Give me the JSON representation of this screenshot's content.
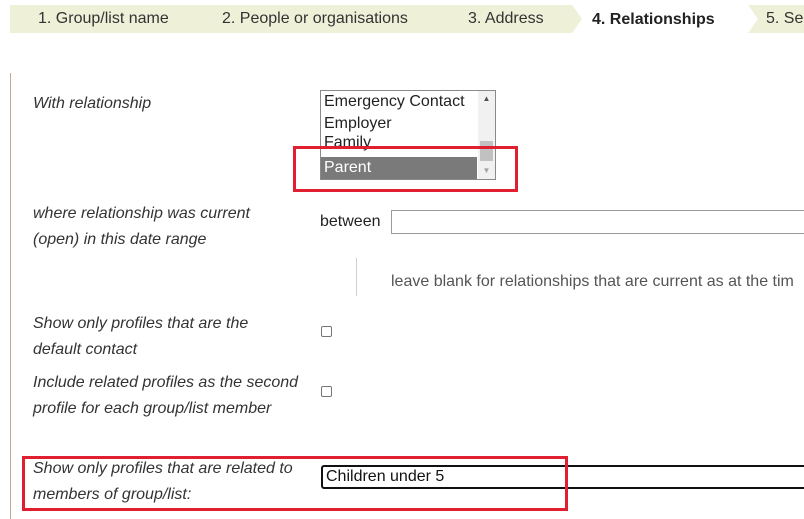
{
  "steps": [
    {
      "label": "1. Group/list name"
    },
    {
      "label": "2. People or organisations"
    },
    {
      "label": "3. Address"
    },
    {
      "label": "4. Relationships",
      "active": true
    },
    {
      "label": "5. Se"
    }
  ],
  "form": {
    "with_relationship": {
      "label": "With relationship",
      "options": [
        "Emergency Contact",
        "Employer",
        "Family",
        "Parent"
      ],
      "selected": "Parent"
    },
    "date_range": {
      "label": "where relationship was current (open) in this date range",
      "between_label": "between",
      "value": "",
      "hint": "leave blank for relationships that are current as at the tim"
    },
    "default_contact": {
      "label": "Show only profiles that are the default contact",
      "checked": false
    },
    "include_related": {
      "label": "Include related profiles as the second profile for each group/list member",
      "checked": false
    },
    "related_group": {
      "label": "Show only profiles that are related to members of group/list:",
      "value": "Children under 5"
    }
  },
  "colors": {
    "highlight": "#e02030",
    "steps_bar": "#eef0d8",
    "selected_option": "#7a7a7a"
  }
}
